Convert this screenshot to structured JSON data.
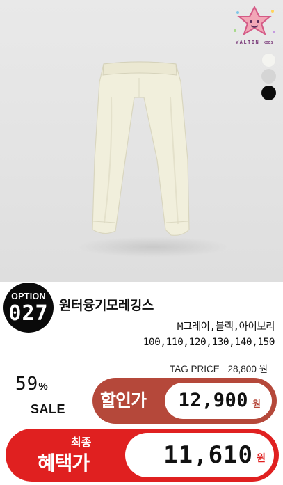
{
  "brand": {
    "name": "WALTON",
    "sub": "KIDS"
  },
  "product": {
    "option_label": "OPTION",
    "option_number": "027",
    "title": "원터융기모레깅스",
    "colors": "M그레이,블랙,아이보리",
    "sizes": "100,110,120,130,140,150"
  },
  "swatches": [
    {
      "name": "ivory",
      "color": "#f4f4f0"
    },
    {
      "name": "gray",
      "color": "#d5d5d5"
    },
    {
      "name": "black",
      "color": "#0b0b0b"
    }
  ],
  "pricing": {
    "tag_label": "TAG PRICE",
    "tag_value": "28,800 원",
    "discount_number": "59",
    "discount_symbol": "%",
    "sale_label": "SALE",
    "sale_price_label": "할인가",
    "sale_price": "12,900",
    "sale_price_unit": "원",
    "final_small_label": "최종",
    "final_label": "혜택가",
    "final_price": "11,610",
    "final_price_unit": "원"
  },
  "colors": {
    "sale_pill": "#b5483a",
    "final_pill": "#e02020",
    "badge": "#0a0a0a"
  }
}
